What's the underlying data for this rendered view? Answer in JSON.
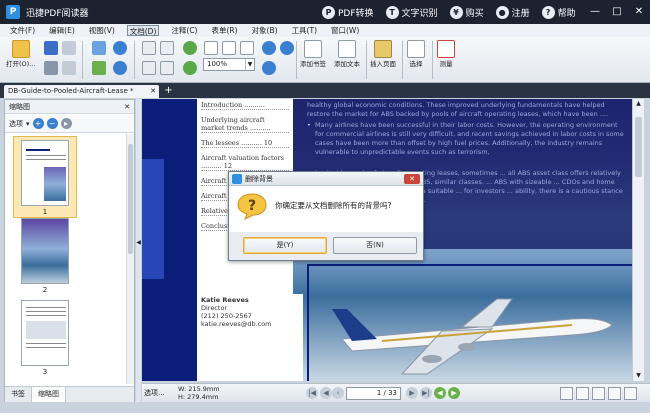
{
  "window": {
    "app_title": "迅捷PDF阅读器",
    "links": [
      {
        "label": "PDF转换",
        "icon": "pdf-convert-icon"
      },
      {
        "label": "文字识别",
        "icon": "ocr-icon"
      },
      {
        "label": "购买",
        "icon": "cart-icon"
      },
      {
        "label": "注册",
        "icon": "user-icon"
      },
      {
        "label": "帮助",
        "icon": "help-icon"
      }
    ],
    "controls": {
      "minimize": "—",
      "maximize": "□",
      "close": "✕"
    }
  },
  "menu": [
    "文件(F)",
    "编辑(E)",
    "视图(V)",
    "文档(D)",
    "注释(C)",
    "表单(R)",
    "对象(B)",
    "工具(T)",
    "窗口(W)"
  ],
  "menu_active_index": 3,
  "toolbar": {
    "open_label": "打开(O)...",
    "zoom_value": "100%",
    "add_bookmark_label": "添加书签",
    "add_text_label": "添加文本",
    "insert_page_label": "插入页面",
    "select_label": "选择",
    "measure_label": "测量"
  },
  "tab": {
    "title": "DB-Guide-to-Pooled-Aircraft-Lease *",
    "close": "✕",
    "add": "+"
  },
  "sidebar": {
    "title": "缩略图",
    "close": "✕",
    "options_label": "选项",
    "pages": [
      "1",
      "2",
      "3"
    ],
    "tabs": [
      "书签",
      "缩略图"
    ]
  },
  "document": {
    "toc": [
      "Introduction ..........",
      "Underlying aircraft market trends ..........",
      "The lessees .......... 10",
      "Aircraft valuation factors .......... 12",
      "Aircraft ... and hist...",
      "Aircraft ... and cash...",
      "Relative ...",
      "Conclusi..."
    ],
    "contact": {
      "name": "Katie Reeves",
      "role": "Director",
      "phone": "(212) 250-2567",
      "email": "katie.reeves@db.com"
    },
    "paragraphs": [
      "healthy global economic conditions. These improved underlying fundamentals have helped restore the market for ABS backed by pools of aircraft operating leases, which have been ....",
      "Many airlines have been successful in their labor costs. However, the operating environment for commercial airlines is still very difficult, and recent savings achieved in labor costs in some cases have been more than offset by high fuel prices. Additionally, the industry remains vulnerable to unpredictable events such as terrorism,",
      "... backed by pools of aircraft operating leases, sometimes ... all ABS asset class offers relatively high spreads ... securities; ABS, CMBS, similar classes. ... ABS with sizeable ... CDOs and home equity ABS ... transactions and are a suitable ... for investors ... ability, there is a cautious stance ... Fairly appropriate for ... aircraft ..."
    ]
  },
  "dialog": {
    "title": "删除背景",
    "close": "✕",
    "message": "你确定要从文档删除所有的背景吗?",
    "yes_label": "是(Y)",
    "no_label": "否(N)"
  },
  "status": {
    "select_label": "选项...",
    "width": "W: 215.9mm",
    "height": "H: 279.4mm",
    "page_current": "1",
    "page_total": "/ 33",
    "page_display": "1 / 33"
  },
  "colors": {
    "titlebar": "#1b2230",
    "accent": "#2f8fe0",
    "doc_navy": "#0b1e7a",
    "thumb_selected": "#fbe8b3"
  }
}
